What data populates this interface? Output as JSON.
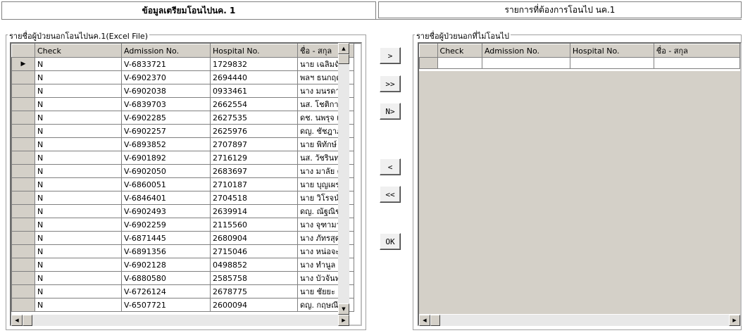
{
  "tabs": [
    {
      "label": "ข้อมูลเตรียมโอนไปนค. 1",
      "active": true
    },
    {
      "label": "รายการที่ต้องการโอนไป นค.1",
      "active": false
    }
  ],
  "left_group": {
    "title": "รายชื่อผู้ป่วยนอกโอนไปนค.1(Excel File)",
    "columns": [
      "Check",
      "Admission No.",
      "Hospital No.",
      "ชื่อ - สกุล"
    ],
    "rows": [
      [
        "N",
        "V-6833721",
        "1729832",
        "นาย เฉลิมฉั"
      ],
      [
        "N",
        "V-6902370",
        "2694440",
        "พลฯ ธนกฤต"
      ],
      [
        "N",
        "V-6902038",
        "0933461",
        "นาง มนรดา"
      ],
      [
        "N",
        "V-6839703",
        "2662554",
        "นส. โชติการ"
      ],
      [
        "N",
        "V-6902285",
        "2627535",
        "ดช. นพรุจ เ"
      ],
      [
        "N",
        "V-6902257",
        "2625976",
        "ดญ. ชัชฎาภ"
      ],
      [
        "N",
        "V-6893852",
        "2707897",
        "นาย พิทักษ์"
      ],
      [
        "N",
        "V-6901892",
        "2716129",
        "นส. วัชรินท"
      ],
      [
        "N",
        "V-6902050",
        "2683697",
        "นาง มาลัย ต"
      ],
      [
        "N",
        "V-6860051",
        "2710187",
        "นาย บุญเผร"
      ],
      [
        "N",
        "V-6846401",
        "2704518",
        "นาย วิโรจน์"
      ],
      [
        "N",
        "V-6902493",
        "2639914",
        "ดญ. ณัฐณิช"
      ],
      [
        "N",
        "V-6902259",
        "2115560",
        "นาง จุฑามาศ"
      ],
      [
        "N",
        "V-6871445",
        "2680904",
        "นาง ภัทรสุด"
      ],
      [
        "N",
        "V-6891356",
        "2715046",
        "นาง หน่อจะร"
      ],
      [
        "N",
        "V-6902128",
        "0498852",
        "นาง ทำนูล ล"
      ],
      [
        "N",
        "V-6880580",
        "2585758",
        "นาง บัวจันท"
      ],
      [
        "N",
        "V-6726124",
        "2678775",
        "นาย ชัยยะ จ"
      ],
      [
        "N",
        "V-6507721",
        "2600094",
        "ดญ. กฤษณีย"
      ]
    ]
  },
  "buttons": {
    "move_one": ">",
    "move_all": ">>",
    "move_n": "N>",
    "back_one": "<",
    "back_all": "<<",
    "ok": "OK"
  },
  "right_group": {
    "title": "รายชื่อผู้ป่วยนอกที่ไม่โอนไป",
    "columns": [
      "Check",
      "Admission No.",
      "Hospital No.",
      "ชื่อ - สกุล"
    ]
  },
  "icons": {
    "row_pointer": "row-pointer-icon",
    "scroll_up": "arrow-up-icon",
    "scroll_down": "arrow-down-icon",
    "scroll_left": "arrow-left-icon",
    "scroll_right": "arrow-right-icon"
  }
}
